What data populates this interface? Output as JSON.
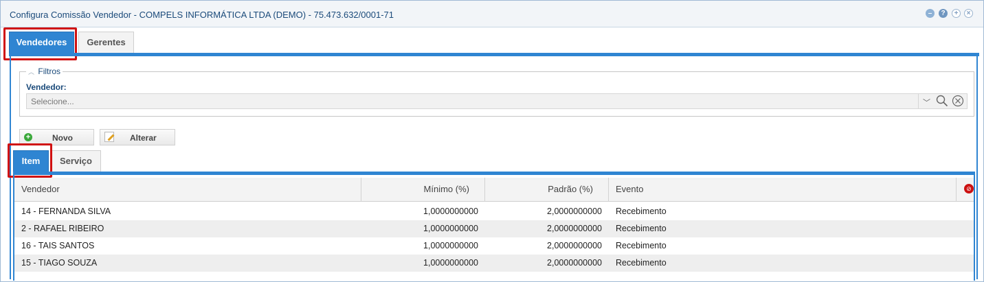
{
  "window": {
    "title": "Configura Comissão Vendedor - COMPELS INFORMÁTICA LTDA (DEMO) - 75.473.632/0001-71"
  },
  "main_tabs": [
    {
      "label": "Vendedores"
    },
    {
      "label": "Gerentes"
    }
  ],
  "filters": {
    "legend": "Filtros",
    "vendedor_label": "Vendedor:",
    "vendedor_placeholder": "Selecione..."
  },
  "toolbar": {
    "new_label": "Novo",
    "edit_label": "Alterar"
  },
  "sub_tabs": [
    {
      "label": "Item"
    },
    {
      "label": "Serviço"
    }
  ],
  "table": {
    "columns": [
      "Vendedor",
      "Mínimo (%)",
      "Padrão (%)",
      "Evento"
    ],
    "rows": [
      {
        "vendedor": "14 - FERNANDA SILVA",
        "minimo": "1,0000000000",
        "padrao": "2,0000000000",
        "evento": "Recebimento"
      },
      {
        "vendedor": "2 - RAFAEL RIBEIRO",
        "minimo": "1,0000000000",
        "padrao": "2,0000000000",
        "evento": "Recebimento"
      },
      {
        "vendedor": "16 - TAIS SANTOS",
        "minimo": "1,0000000000",
        "padrao": "2,0000000000",
        "evento": "Recebimento"
      },
      {
        "vendedor": "15 - TIAGO SOUZA",
        "minimo": "1,0000000000",
        "padrao": "2,0000000000",
        "evento": "Recebimento"
      }
    ]
  },
  "colors": {
    "accent": "#2f85d2",
    "highlight": "#d01010",
    "title_text": "#1a4a7a"
  }
}
